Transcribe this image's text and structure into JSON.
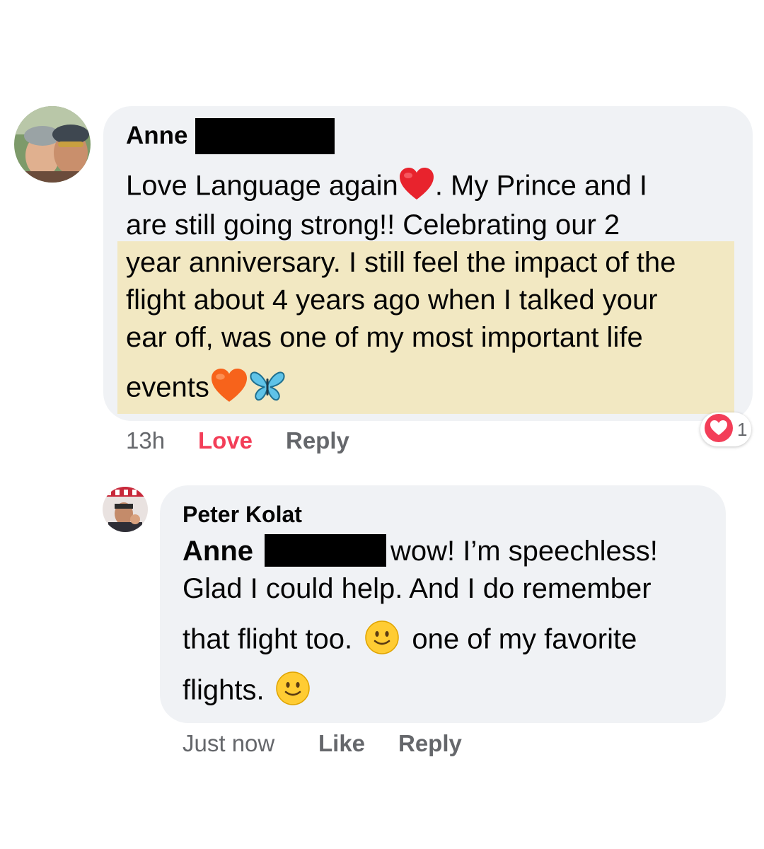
{
  "comment1": {
    "author": "Anne",
    "lines": [
      "Love Language again",
      ". My Prince and I",
      "are still going strong!! Celebrating our 2",
      "year anniversary. I still feel the impact of the",
      "flight about 4 years ago when I talked your",
      "ear off, was one of my most important life",
      "events"
    ],
    "time": "13h",
    "love_label": "Love",
    "reply_label": "Reply",
    "reaction_count": "1",
    "colors": {
      "love": "#f33e58",
      "highlight": "#f2e8c2",
      "bubble": "#f0f2f5"
    }
  },
  "comment2": {
    "author": "Peter Kolat",
    "mention": "Anne",
    "lines": [
      "wow! I’m speechless!",
      "Glad I could help.  And I do remember",
      "that flight too.",
      "one of my favorite",
      "flights."
    ],
    "time": "Just now",
    "like_label": "Like",
    "reply_label": "Reply"
  },
  "icons": [
    "red-heart-icon",
    "orange-heart-icon",
    "butterfly-icon",
    "smiley-icon",
    "love-reaction-icon"
  ]
}
